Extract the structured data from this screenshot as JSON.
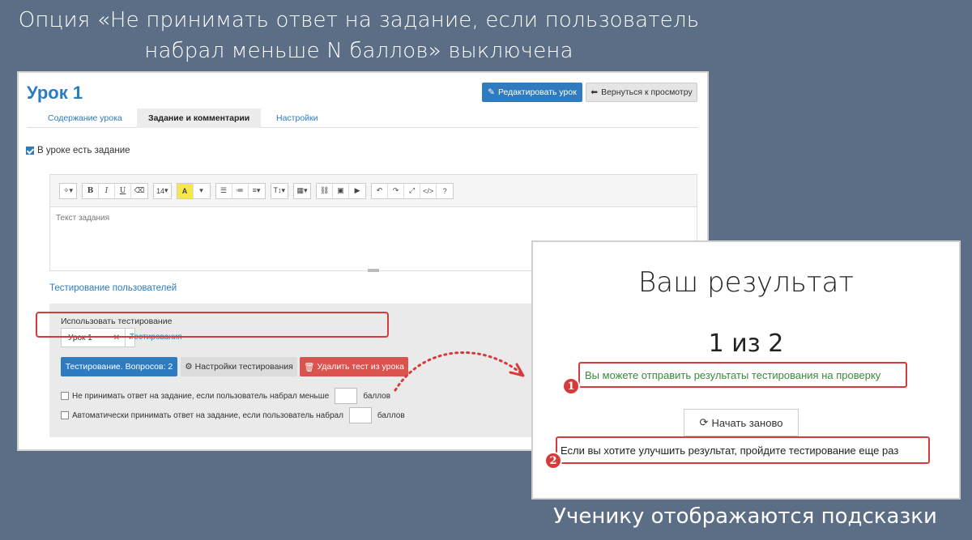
{
  "captions": {
    "top": "Опция «Не принимать ответ на задание, если пользователь набрал меньше N баллов» выключена",
    "bottom": "Ученику отображаются подсказки"
  },
  "editor": {
    "title": "Урок 1",
    "edit_button": "Редактировать урок",
    "back_button": "Вернуться к просмотру",
    "tabs": [
      {
        "label": "Содержание урока",
        "active": false
      },
      {
        "label": "Задание и комментарии",
        "active": true
      },
      {
        "label": "Настройки",
        "active": false
      }
    ],
    "has_task_label": "В уроке есть задание",
    "has_task_checked": true,
    "toolbar": {
      "font_size": "14",
      "bold": "B",
      "italic": "I",
      "underline": "U",
      "help": "?"
    },
    "task_placeholder": "Текст задания",
    "testing_link": "Тестирование пользователей",
    "use_testing_label": "Использовать тестирование",
    "selected_test": "Урок 1",
    "tests_link": "Тестирования",
    "questions_button": "Тестирование. Вопросов: 2",
    "settings_button": "Настройки тестирования",
    "delete_button": "Удалить тест из урока",
    "option1_before": "Не принимать ответ на задание, если пользователь набрал меньше",
    "option1_after": "баллов",
    "option2_before": "Автоматически принимать ответ на задание, если пользователь набрал",
    "option2_after": "баллов"
  },
  "result": {
    "title": "Ваш результат",
    "score": "1 из 2",
    "hint1": "Вы можете отправить результаты тестирования на проверку",
    "restart_button": "Начать заново",
    "hint2": "Если вы хотите улучшить результат, пройдите тестирование еще раз",
    "marker1": "1",
    "marker2": "2"
  },
  "colors": {
    "accent": "#2f7bbf",
    "danger": "#d63b3b",
    "background": "#5b6e85"
  }
}
